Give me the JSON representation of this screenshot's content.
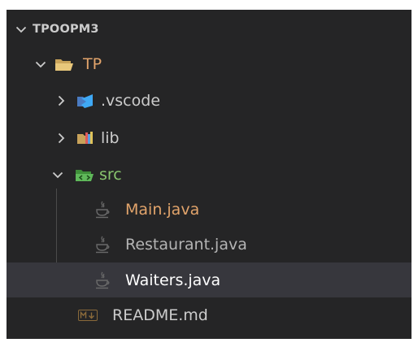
{
  "colors": {
    "panel_bg": "#252526",
    "selected_bg": "#37373d",
    "modified_orange": "#e2a46b",
    "untracked_green": "#89c46e",
    "default_text": "#cccccc"
  },
  "explorer": {
    "workspace_title": "TPOOPM3",
    "tree": [
      {
        "label": "TP",
        "kind": "folder",
        "icon": "folder-open-icon",
        "expanded": true
      },
      {
        "label": ".vscode",
        "kind": "folder",
        "icon": "vscode-folder-icon",
        "expanded": false
      },
      {
        "label": "lib",
        "kind": "folder",
        "icon": "lib-folder-icon",
        "expanded": false
      },
      {
        "label": "src",
        "kind": "folder",
        "icon": "src-folder-icon",
        "expanded": true
      },
      {
        "label": "Main.java",
        "kind": "file",
        "icon": "java-icon"
      },
      {
        "label": "Restaurant.java",
        "kind": "file",
        "icon": "java-icon"
      },
      {
        "label": "Waiters.java",
        "kind": "file",
        "icon": "java-icon",
        "selected": true
      },
      {
        "label": "README.md",
        "kind": "file",
        "icon": "markdown-icon"
      }
    ]
  }
}
